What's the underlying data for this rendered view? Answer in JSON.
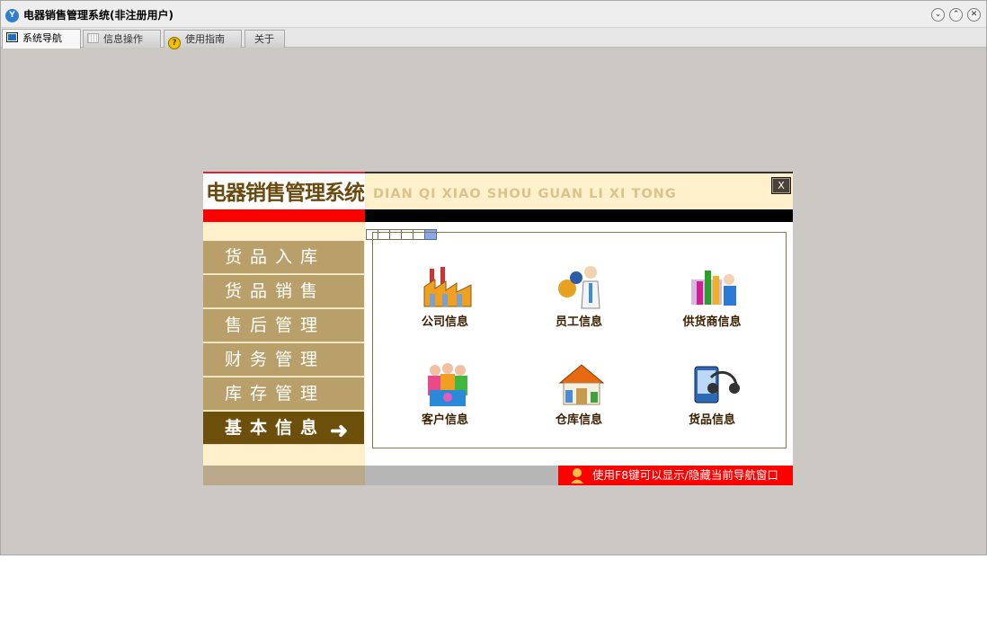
{
  "window": {
    "title": "电器销售管理系统(非注册用户)",
    "app_icon": "Y",
    "controls": [
      "minimize-icon",
      "maximize-icon",
      "close-icon"
    ]
  },
  "tabs": [
    {
      "label": "系统导航",
      "icon": "monitor-icon",
      "active": true
    },
    {
      "label": "信息操作",
      "icon": "grid-icon",
      "active": false
    },
    {
      "label": "使用指南",
      "icon": "guide-icon",
      "active": false
    },
    {
      "label": "关于",
      "icon": "",
      "active": false
    }
  ],
  "panel": {
    "brand": "电器销售管理系统",
    "pinyin": "DIAN QI XIAO SHOU GUAN LI XI TONG",
    "close_label": "X",
    "menu": [
      {
        "label": "货品入库"
      },
      {
        "label": "货品销售"
      },
      {
        "label": "售后管理"
      },
      {
        "label": "财务管理"
      },
      {
        "label": "库存管理"
      },
      {
        "label": "基本信息",
        "active": true
      }
    ],
    "pager": {
      "count": 6,
      "current": 6
    },
    "tiles": [
      {
        "label": "公司信息",
        "icon": "factory-icon"
      },
      {
        "label": "员工信息",
        "icon": "employee-icon"
      },
      {
        "label": "供货商信息",
        "icon": "supplier-icon"
      },
      {
        "label": "客户信息",
        "icon": "customers-icon"
      },
      {
        "label": "仓库信息",
        "icon": "warehouse-icon"
      },
      {
        "label": "货品信息",
        "icon": "goods-icon"
      }
    ],
    "hint": "使用F8键可以显示/隐藏当前导航窗口"
  },
  "colors": {
    "menu_bg": "#b9a06a",
    "menu_active": "#6c4f0b",
    "panel_bg": "#fff0cc",
    "hint_bg": "#ff0000"
  }
}
